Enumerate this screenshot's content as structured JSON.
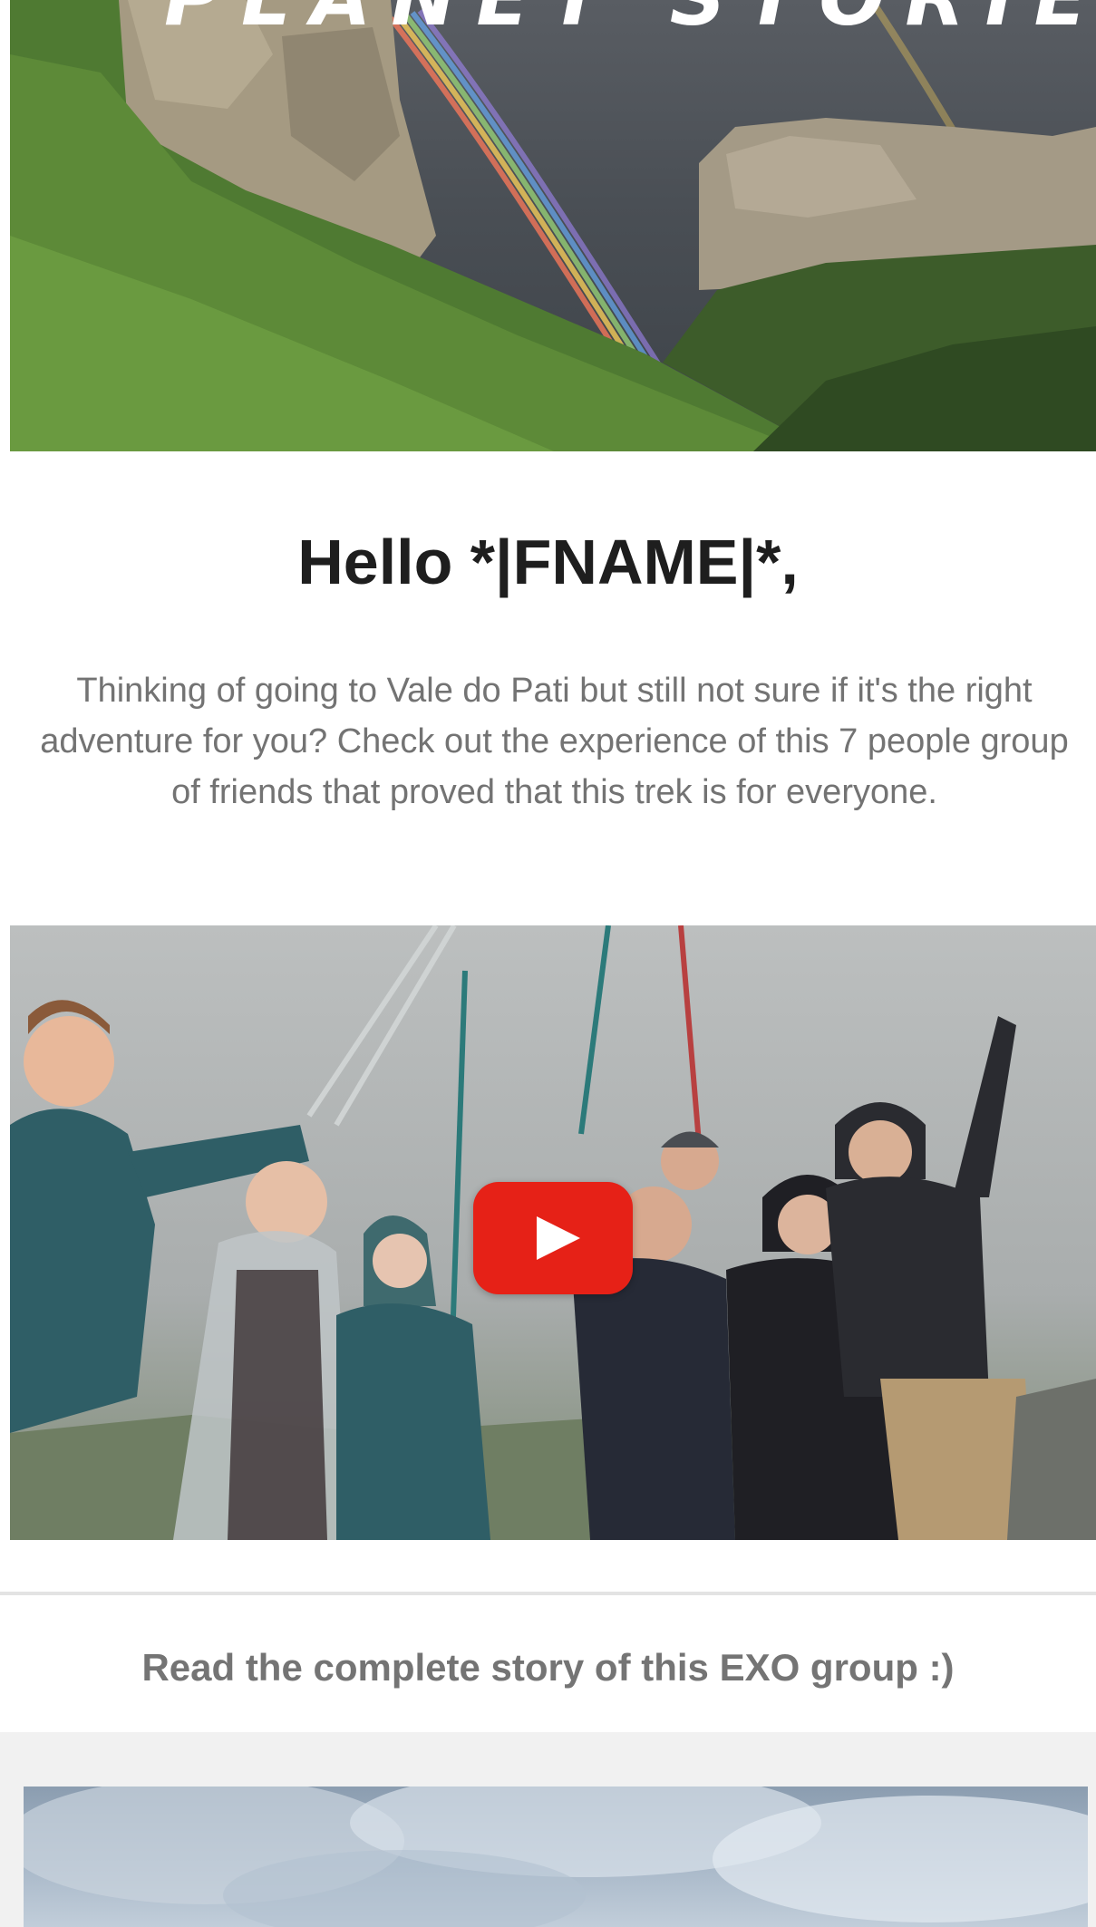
{
  "hero": {
    "title": "PLANET STORIES"
  },
  "greeting": "Hello *|FNAME|*,",
  "intro": {
    "line1": "Thinking of going to Vale do Pati but still not sure if it's the right",
    "line2": "adventure for you? Check out the experience of this 7 people group",
    "line3": "of friends that proved that this trek is for everyone."
  },
  "video": {
    "play_icon": "play-icon",
    "play_color": "#e62117"
  },
  "cta": {
    "label": "Read the complete story of this EXO group :)"
  },
  "colors": {
    "greeting_text": "#1e1e1e",
    "body_text": "#737373",
    "cta_text": "#747474",
    "divider": "#e3e3e3",
    "section_bg": "#f1f1f1"
  }
}
